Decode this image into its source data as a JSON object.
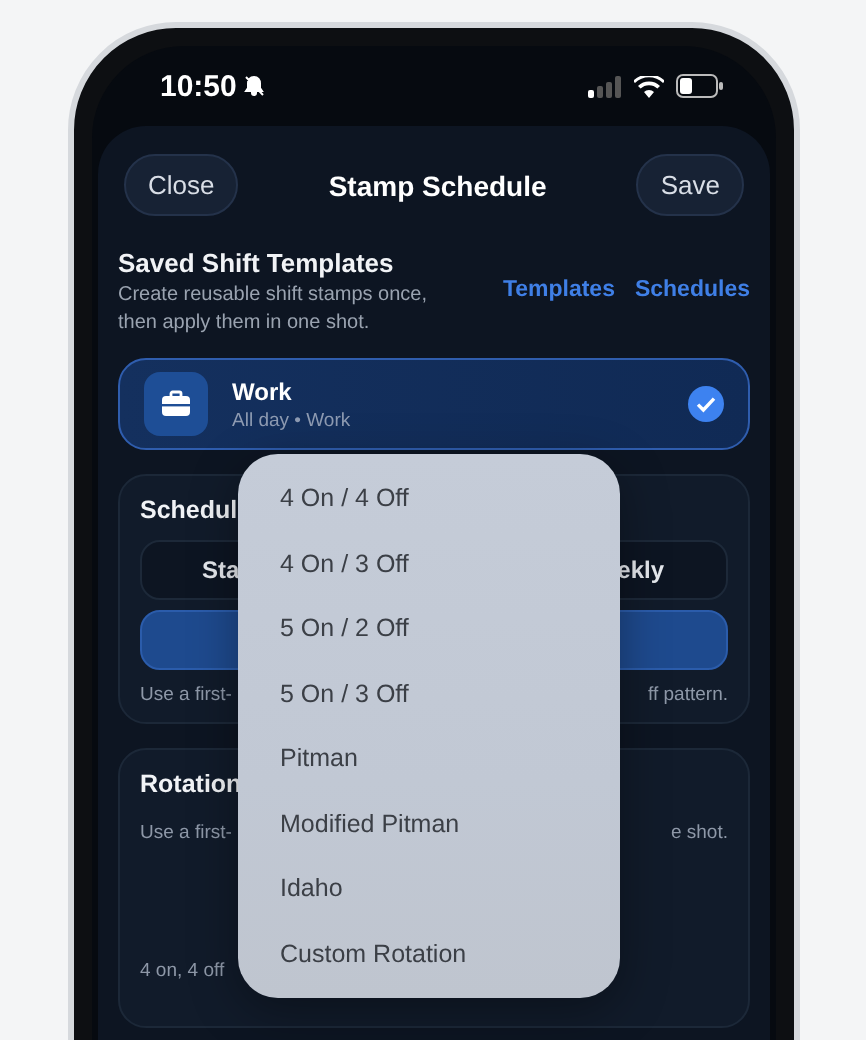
{
  "status_bar": {
    "time": "10:50"
  },
  "header": {
    "close": "Close",
    "title": "Stamp Schedule",
    "save": "Save"
  },
  "templates": {
    "title": "Saved Shift Templates",
    "description": "Create reusable shift stamps once, then apply them in one shot.",
    "links": [
      "Templates",
      "Schedules"
    ],
    "items": [
      {
        "name": "Work",
        "detail": "All day • Work",
        "selected": true
      }
    ]
  },
  "schedule_card": {
    "title": "Schedul",
    "segments": [
      "Sta",
      "ekly"
    ],
    "note_start": "Use a first-",
    "note_end": "ff pattern."
  },
  "rotation_card": {
    "title": "Rotation",
    "note_start": "Use a first-",
    "note_end": "e shot.",
    "pattern": "4 on, 4 off"
  },
  "menu": {
    "items": [
      "4 On / 4 Off",
      "4 On / 3 Off",
      "5 On / 2 Off",
      "5 On / 3 Off",
      "Pitman",
      "Modified Pitman",
      "Idaho",
      "Custom Rotation"
    ]
  }
}
